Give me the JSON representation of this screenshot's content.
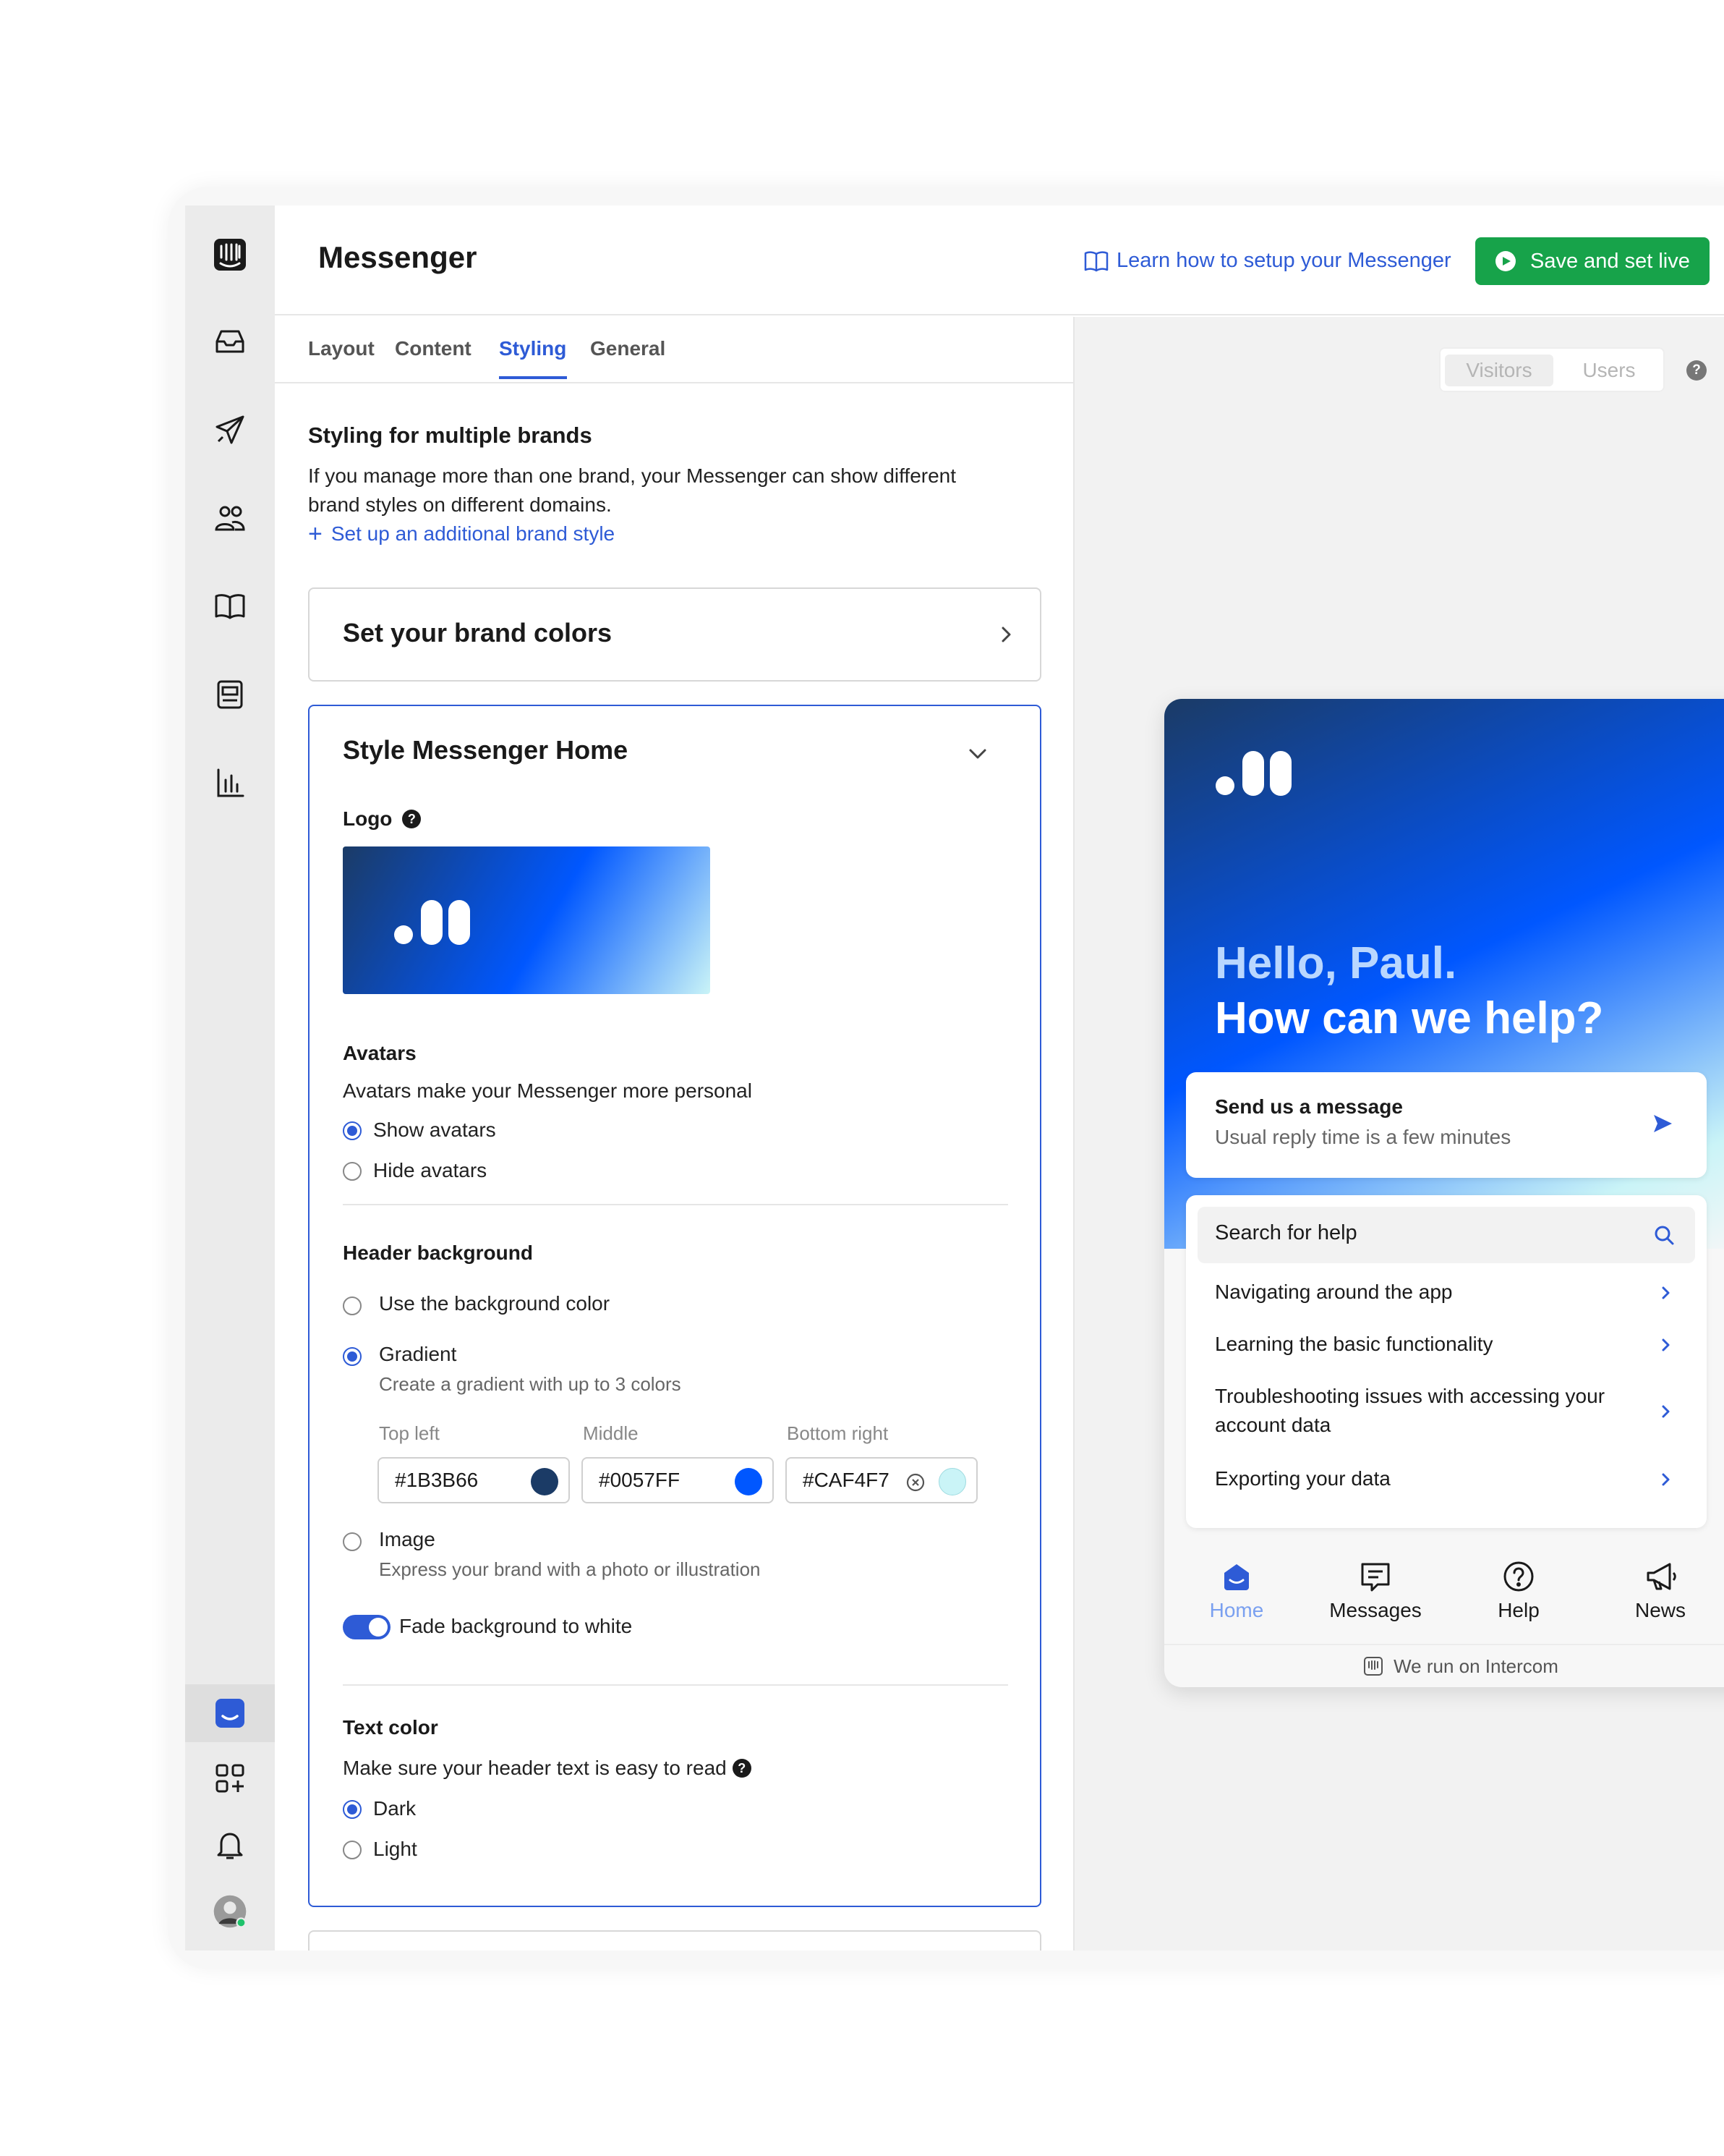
{
  "header": {
    "title": "Messenger",
    "learn_link": "Learn how to setup your Messenger",
    "save_button": "Save and set live"
  },
  "tabs": [
    "Layout",
    "Content",
    "Styling",
    "General"
  ],
  "active_tab": "Styling",
  "multi_brand": {
    "title": "Styling for multiple brands",
    "description_line1": "If you manage more than one brand, your Messenger can show different",
    "description_line2": "brand styles on different domains.",
    "add_link": "Set up an additional brand style"
  },
  "brand_colors_card": {
    "title": "Set your brand colors"
  },
  "style_home": {
    "title": "Style Messenger Home",
    "logo_label": "Logo",
    "avatars": {
      "title": "Avatars",
      "description": "Avatars make your Messenger more personal",
      "options": [
        "Show avatars",
        "Hide avatars"
      ],
      "selected": "Show avatars"
    },
    "header_background": {
      "title": "Header background",
      "option_color": "Use the background color",
      "option_gradient": "Gradient",
      "gradient_hint": "Create a gradient with up to 3 colors",
      "top_left_label": "Top left",
      "top_left_value": "#1B3B66",
      "middle_label": "Middle",
      "middle_value": "#0057FF",
      "bottom_right_label": "Bottom right",
      "bottom_right_value": "#CAF4F7",
      "option_image": "Image",
      "image_hint": "Express your brand with a photo or illustration",
      "selected": "Gradient",
      "fade_label": "Fade background to white",
      "fade_enabled": true
    },
    "text_color": {
      "title": "Text color",
      "description": "Make sure your header text is easy to read",
      "options": [
        "Dark",
        "Light"
      ],
      "selected": "Dark"
    }
  },
  "preview": {
    "segment": [
      "Visitors",
      "Users"
    ],
    "selected_segment": "Visitors",
    "greeting_line1": "Hello, Paul.",
    "greeting_line2": "How can we help?",
    "message_card_title": "Send us a message",
    "message_card_subtitle": "Usual reply time is a few minutes",
    "search_placeholder": "Search for help",
    "articles": [
      "Navigating around the app",
      "Learning the basic functionality",
      "Troubleshooting issues with accessing your account data",
      "Exporting your data"
    ],
    "nav": [
      "Home",
      "Messages",
      "Help",
      "News"
    ],
    "active_nav": "Home",
    "footer": "We run on Intercom"
  },
  "colors": {
    "accent": "#2E5BD6",
    "save_green": "#17A34A",
    "gradient_top_left": "#1B3B66",
    "gradient_middle": "#0057FF",
    "gradient_bottom_right": "#CAF4F7"
  }
}
